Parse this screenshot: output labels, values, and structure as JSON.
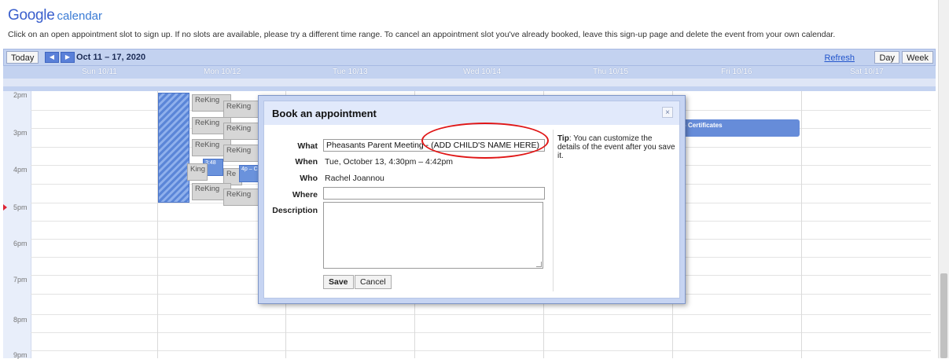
{
  "app": {
    "logo_google": "Google",
    "logo_calendar": "calendar",
    "instructions": "Click on an open appointment slot to sign up. If no slots are available, please try a different time range. To cancel an appointment slot you've already booked, leave this sign-up page and delete the event from your own calendar."
  },
  "toolbar": {
    "today": "Today",
    "range": "Oct 11 – 17, 2020",
    "refresh": "Refresh",
    "day": "Day",
    "week": "Week"
  },
  "days": [
    "Sun 10/11",
    "Mon 10/12",
    "Tue 10/13",
    "Wed 10/14",
    "Thu 10/15",
    "Fri 10/16",
    "Sat 10/17"
  ],
  "hours": [
    "2pm",
    "3pm",
    "4pm",
    "5pm",
    "6pm",
    "7pm",
    "8pm",
    "9pm"
  ],
  "calendar_events": {
    "slot_label": "ReKing",
    "slot_label_short": "King",
    "slot_label_tiny": "Re",
    "event_small_1": "3:48",
    "event_small_2": "4p – C",
    "cert": "p - Certificates"
  },
  "dialog": {
    "title": "Book an appointment",
    "close": "×",
    "what_label": "What",
    "what_value": "Pheasants Parent Meeting - (ADD CHILD'S NAME HERE)",
    "when_label": "When",
    "when_value": "Tue, October 13, 4:30pm – 4:42pm",
    "who_label": "Who",
    "who_value": "Rachel Joannou",
    "where_label": "Where",
    "where_value": "",
    "description_label": "Description",
    "save": "Save",
    "cancel": "Cancel",
    "tip_label": "Tip",
    "tip_text": ": You can customize the details of the event after you save it."
  },
  "colors": {
    "toolbar": "#c3d2f0",
    "event_blue": "#668cd9",
    "annotation_red": "#e01616"
  }
}
